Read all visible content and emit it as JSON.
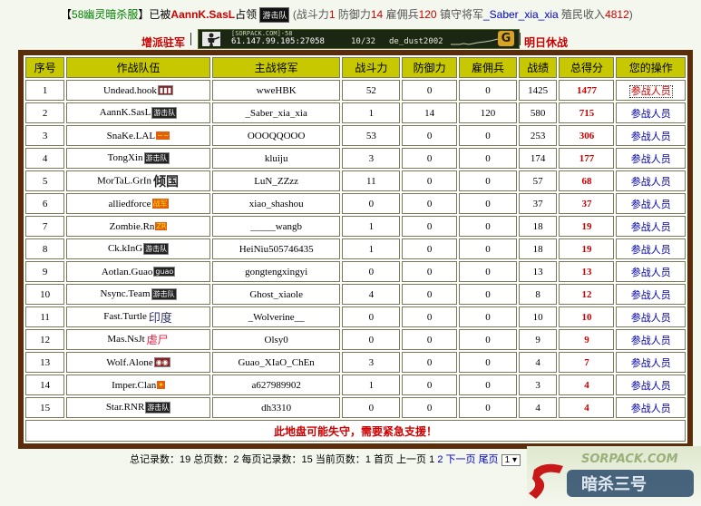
{
  "header": {
    "bracket_open": "【",
    "server_name": "58幽灵暗杀服",
    "bracket_close": "】",
    "occupied_by_prefix": "已被",
    "occupier": "AannK.SasL",
    "occupied_suffix": "占领",
    "occupier_badge": "游击队",
    "stats_open": "(战斗力",
    "combat_power": "1",
    "defense_label": "防御力",
    "defense": "14",
    "mercs_label": "雇佣兵",
    "mercs": "120",
    "general_label": "镇守将军",
    "general": "_Saber_xia_xia",
    "income_label": "殖民收入",
    "income": "4812",
    "stats_close": ")"
  },
  "status": {
    "guard_label": "增派驻军",
    "truce_label": "明日休战",
    "server_small": "[SORPACK.COM]-58",
    "server_ip": "61.147.99.105:27058",
    "players": "10/32",
    "map": "de_dust2002",
    "g_icon": "G"
  },
  "table": {
    "headers": [
      "序号",
      "作战队伍",
      "主战将军",
      "战斗力",
      "防御力",
      "雇佣兵",
      "战绩",
      "总得分",
      "您的操作"
    ],
    "action_label": "参战人员",
    "rows": [
      {
        "no": "1",
        "team": "Undead.hook",
        "tag": "▮▮▮",
        "tagStyle": "dark",
        "general": "wweHBK",
        "power": "52",
        "defense": "0",
        "mercs": "0",
        "record": "1425",
        "score": "1477"
      },
      {
        "no": "2",
        "team": "AannK.SasL",
        "tag": "游击队",
        "tagStyle": "",
        "general": "_Saber_xia_xia",
        "power": "1",
        "defense": "14",
        "mercs": "120",
        "record": "580",
        "score": "715"
      },
      {
        "no": "3",
        "team": "SnaKe.LAL",
        "tag": "~~",
        "tagStyle": "warm",
        "general": "OOOQQOOO",
        "power": "53",
        "defense": "0",
        "mercs": "0",
        "record": "253",
        "score": "306"
      },
      {
        "no": "4",
        "team": "TongXin",
        "tag": "游击队",
        "tagStyle": "",
        "general": "kluiju",
        "power": "3",
        "defense": "0",
        "mercs": "0",
        "record": "174",
        "score": "177"
      },
      {
        "no": "5",
        "team": "MorTaL.GrIn",
        "tag": "倾国",
        "tagStyle": "big",
        "general": "LuN_ZZzz",
        "power": "11",
        "defense": "0",
        "mercs": "0",
        "record": "57",
        "score": "68"
      },
      {
        "no": "6",
        "team": "alliedforce",
        "tag": "战军",
        "tagStyle": "warm",
        "general": "xiao_shashou",
        "power": "0",
        "defense": "0",
        "mercs": "0",
        "record": "37",
        "score": "37"
      },
      {
        "no": "7",
        "team": "Zombie.Rn",
        "tag": "ZR",
        "tagStyle": "warm",
        "general": "_____wangb",
        "power": "1",
        "defense": "0",
        "mercs": "0",
        "record": "18",
        "score": "19"
      },
      {
        "no": "8",
        "team": "Ck.kInG",
        "tag": "游击队",
        "tagStyle": "",
        "general": "HeiNiu505746435",
        "power": "1",
        "defense": "0",
        "mercs": "0",
        "record": "18",
        "score": "19"
      },
      {
        "no": "9",
        "team": "Aotlan.Guao",
        "tag": "guao",
        "tagStyle": "",
        "general": "gongtengxingyi",
        "power": "0",
        "defense": "0",
        "mercs": "0",
        "record": "13",
        "score": "13"
      },
      {
        "no": "10",
        "team": "Nsync.Team",
        "tag": "游击队",
        "tagStyle": "",
        "general": "Ghost_xiaole",
        "power": "4",
        "defense": "0",
        "mercs": "0",
        "record": "8",
        "score": "12"
      },
      {
        "no": "11",
        "team": "Fast.Turtle",
        "tag": "印度",
        "tagStyle": "blue",
        "general": "_Wolverine__",
        "power": "0",
        "defense": "0",
        "mercs": "0",
        "record": "10",
        "score": "10"
      },
      {
        "no": "12",
        "team": "Mas.NsJt",
        "tag": "虐尸",
        "tagStyle": "pink",
        "general": "Olsy0",
        "power": "0",
        "defense": "0",
        "mercs": "0",
        "record": "9",
        "score": "9"
      },
      {
        "no": "13",
        "team": "Wolf.Alone",
        "tag": "◉◉",
        "tagStyle": "dark",
        "general": "Guao_XIaO_ChEn",
        "power": "3",
        "defense": "0",
        "mercs": "0",
        "record": "4",
        "score": "7"
      },
      {
        "no": "14",
        "team": "Imper.Clan",
        "tag": "✦",
        "tagStyle": "warm",
        "general": "a627989902",
        "power": "1",
        "defense": "0",
        "mercs": "0",
        "record": "3",
        "score": "4"
      },
      {
        "no": "15",
        "team": "Star.RNR",
        "tag": "游击队",
        "tagStyle": "",
        "general": "dh3310",
        "power": "0",
        "defense": "0",
        "mercs": "0",
        "record": "4",
        "score": "4"
      }
    ],
    "footer": "此地盘可能失守，需要紧急支援！"
  },
  "pager": {
    "total_records_label": "总记录数：",
    "total_records": "19",
    "total_pages_label": "总页数：",
    "total_pages": "2",
    "per_page_label": "每页记录数：",
    "per_page": "15",
    "current_label": "当前页数：",
    "current": "1",
    "first": "首页",
    "prev": "上一页",
    "page1": "1",
    "page2": "2",
    "next": "下一页",
    "last": "尾页",
    "select_value": "1"
  },
  "logo": {
    "text": "SORPACK.COM",
    "sub": "暗杀三号"
  },
  "colors": {
    "frame": "#5b2d0b",
    "header_bg": "#c8c800",
    "score": "#cc0000",
    "link": "#0000cc"
  }
}
